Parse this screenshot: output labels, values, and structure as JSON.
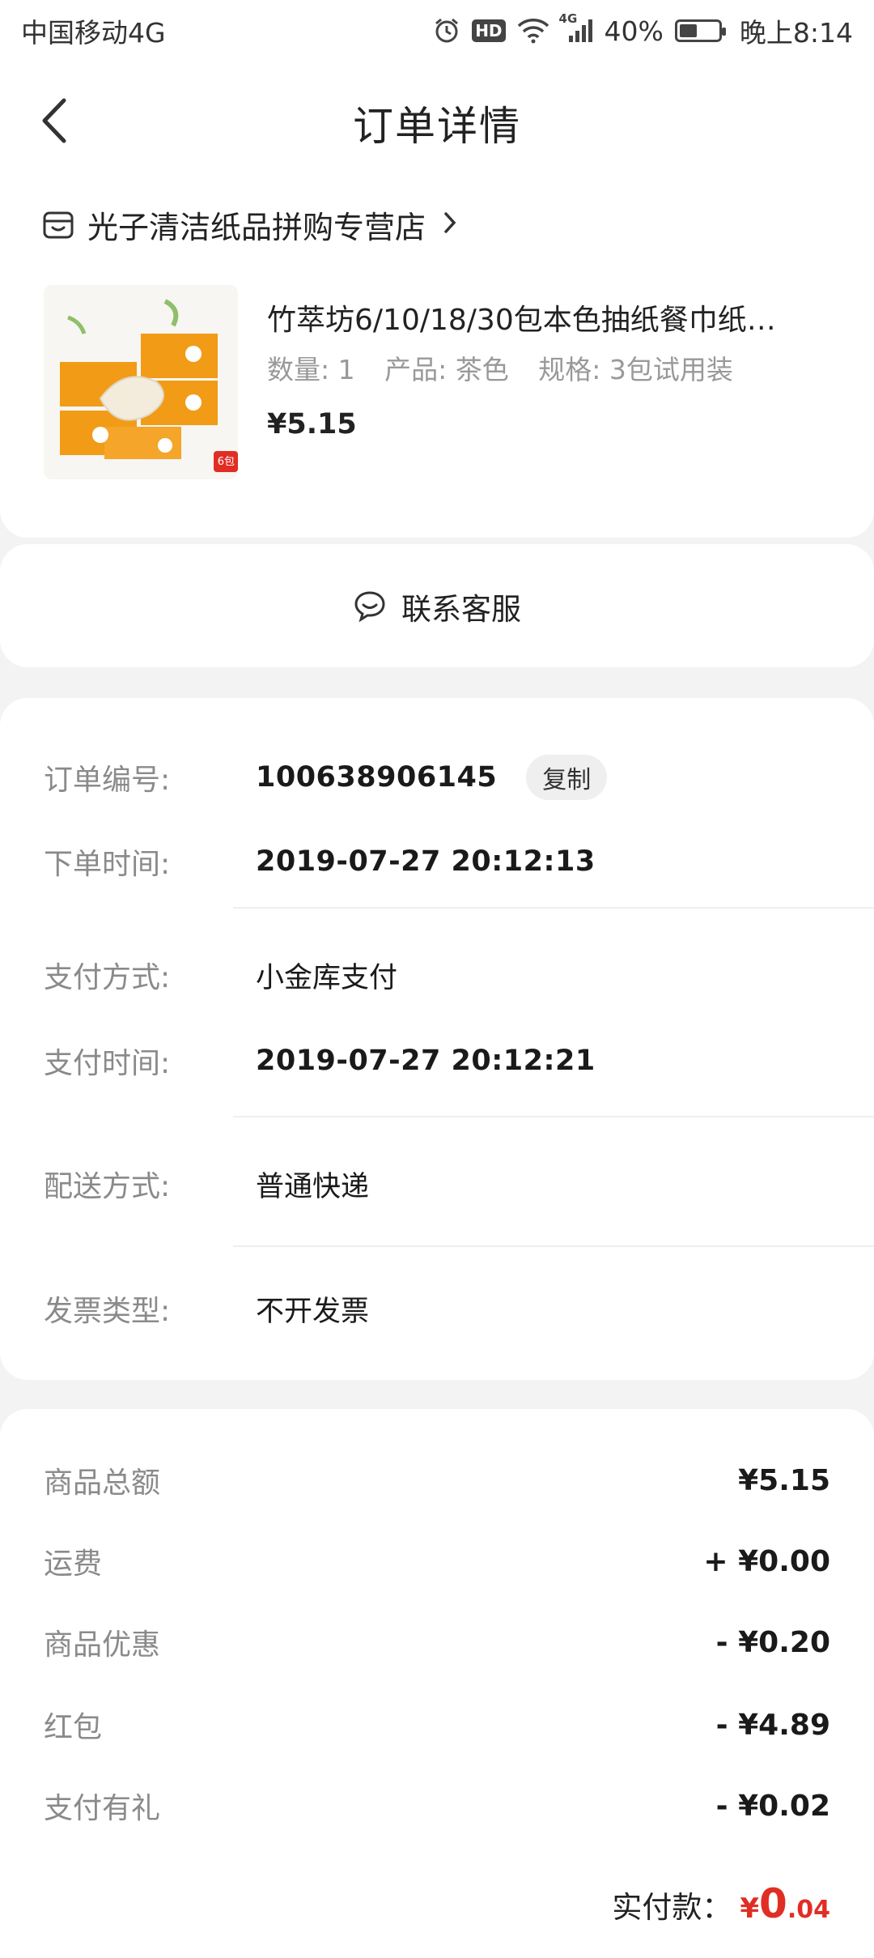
{
  "status_bar": {
    "carrier": "中国移动4G",
    "network": "4G",
    "hd_badge": "HD",
    "battery": "40%",
    "time": "晚上8:14"
  },
  "nav": {
    "title": "订单详情",
    "back_icon": "chevron-left-icon"
  },
  "shop": {
    "name": "光子清洁纸品拼购专营店",
    "icon": "store-icon"
  },
  "goods": {
    "title": "竹萃坊6/10/18/30包本色抽纸餐巾纸…",
    "qty_label": "数量: 1",
    "product_label": "产品: 茶色",
    "spec_label": "规格: 3包试用装",
    "price": "¥5.15",
    "thumb_badge": "6包"
  },
  "service": {
    "label": "联系客服",
    "icon": "chat-icon"
  },
  "info": {
    "order_no_label": "订单编号:",
    "order_no": "100638906145",
    "copy_label": "复制",
    "order_time_label": "下单时间:",
    "order_time": "2019-07-27 20:12:13",
    "pay_method_label": "支付方式:",
    "pay_method": "小金库支付",
    "pay_time_label": "支付时间:",
    "pay_time": "2019-07-27 20:12:21",
    "delivery_label": "配送方式:",
    "delivery": "普通快递",
    "invoice_label": "发票类型:",
    "invoice": "不开发票"
  },
  "price": {
    "rows": [
      {
        "label": "商品总额",
        "value": "¥5.15"
      },
      {
        "label": "运费",
        "value": "+ ¥0.00"
      },
      {
        "label": "商品优惠",
        "value": "- ¥0.20"
      },
      {
        "label": "红包",
        "value": "- ¥4.89"
      },
      {
        "label": "支付有礼",
        "value": "- ¥0.02"
      }
    ],
    "paid_label": "实付款：",
    "paid_currency": "¥",
    "paid_int": "0",
    "paid_dec": ".04",
    "accent_color": "#e02e24"
  }
}
